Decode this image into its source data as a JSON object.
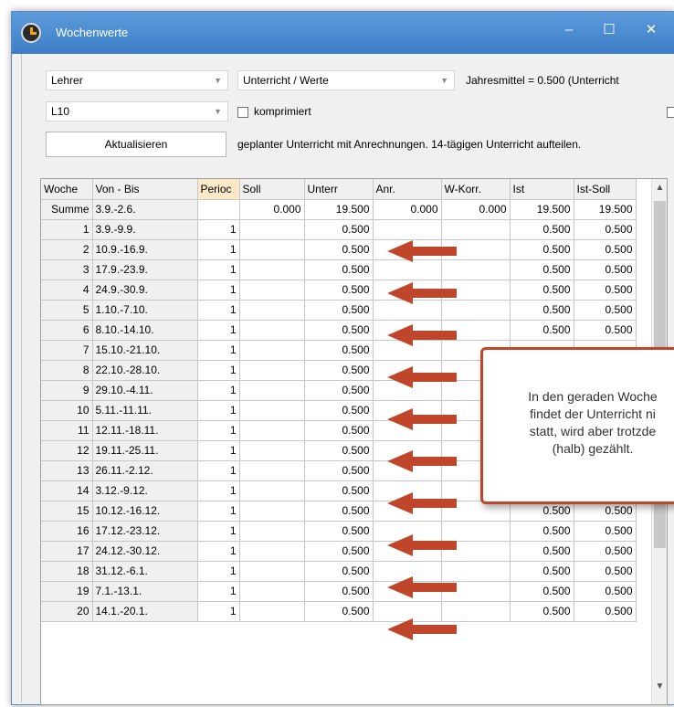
{
  "window": {
    "title": "Wochenwerte",
    "minimize_label": "–",
    "maximize_label": "☐",
    "close_label": "✕"
  },
  "controls": {
    "type_combo": "Lehrer",
    "mode_combo": "Unterricht / Werte",
    "info_text": "Jahresmittel = 0.500 (Unterricht",
    "element_combo": "L10",
    "compress_label": "komprimiert",
    "refresh_button": "Aktualisieren",
    "description": "geplanter Unterricht mit Anrechnungen. 14-tägigen Unterricht aufteilen."
  },
  "grid": {
    "headers": [
      "Woche",
      "Von - Bis",
      "Perioc",
      "Soll",
      "Unterr",
      "Anr.",
      "W-Korr.",
      "Ist",
      "Ist-Soll"
    ],
    "summary": {
      "label": "Summe",
      "range": "3.9.-2.6.",
      "period": "",
      "soll": "0.000",
      "unterr": "19.500",
      "anr": "0.000",
      "wkorr": "0.000",
      "ist": "19.500",
      "istsoll": "19.500"
    },
    "rows": [
      {
        "week": "1",
        "range": "3.9.-9.9.",
        "period": "1",
        "unterr": "0.500",
        "ist": "0.500",
        "istsoll": "0.500"
      },
      {
        "week": "2",
        "range": "10.9.-16.9.",
        "period": "1",
        "unterr": "0.500",
        "ist": "0.500",
        "istsoll": "0.500"
      },
      {
        "week": "3",
        "range": "17.9.-23.9.",
        "period": "1",
        "unterr": "0.500",
        "ist": "0.500",
        "istsoll": "0.500"
      },
      {
        "week": "4",
        "range": "24.9.-30.9.",
        "period": "1",
        "unterr": "0.500",
        "ist": "0.500",
        "istsoll": "0.500"
      },
      {
        "week": "5",
        "range": "1.10.-7.10.",
        "period": "1",
        "unterr": "0.500",
        "ist": "0.500",
        "istsoll": "0.500"
      },
      {
        "week": "6",
        "range": "8.10.-14.10.",
        "period": "1",
        "unterr": "0.500",
        "ist": "0.500",
        "istsoll": "0.500"
      },
      {
        "week": "7",
        "range": "15.10.-21.10.",
        "period": "1",
        "unterr": "0.500",
        "ist": "",
        "istsoll": ""
      },
      {
        "week": "8",
        "range": "22.10.-28.10.",
        "period": "1",
        "unterr": "0.500",
        "ist": "",
        "istsoll": ""
      },
      {
        "week": "9",
        "range": "29.10.-4.11.",
        "period": "1",
        "unterr": "0.500",
        "ist": "",
        "istsoll": ""
      },
      {
        "week": "10",
        "range": "5.11.-11.11.",
        "period": "1",
        "unterr": "0.500",
        "ist": "",
        "istsoll": ""
      },
      {
        "week": "11",
        "range": "12.11.-18.11.",
        "period": "1",
        "unterr": "0.500",
        "ist": "",
        "istsoll": ""
      },
      {
        "week": "12",
        "range": "19.11.-25.11.",
        "period": "1",
        "unterr": "0.500",
        "ist": "",
        "istsoll": ""
      },
      {
        "week": "13",
        "range": "26.11.-2.12.",
        "period": "1",
        "unterr": "0.500",
        "ist": "0.500",
        "istsoll": "0.500"
      },
      {
        "week": "14",
        "range": "3.12.-9.12.",
        "period": "1",
        "unterr": "0.500",
        "ist": "0.500",
        "istsoll": "0.500"
      },
      {
        "week": "15",
        "range": "10.12.-16.12.",
        "period": "1",
        "unterr": "0.500",
        "ist": "0.500",
        "istsoll": "0.500"
      },
      {
        "week": "16",
        "range": "17.12.-23.12.",
        "period": "1",
        "unterr": "0.500",
        "ist": "0.500",
        "istsoll": "0.500"
      },
      {
        "week": "17",
        "range": "24.12.-30.12.",
        "period": "1",
        "unterr": "0.500",
        "ist": "0.500",
        "istsoll": "0.500"
      },
      {
        "week": "18",
        "range": "31.12.-6.1.",
        "period": "1",
        "unterr": "0.500",
        "ist": "0.500",
        "istsoll": "0.500"
      },
      {
        "week": "19",
        "range": "7.1.-13.1.",
        "period": "1",
        "unterr": "0.500",
        "ist": "0.500",
        "istsoll": "0.500"
      },
      {
        "week": "20",
        "range": "14.1.-20.1.",
        "period": "1",
        "unterr": "0.500",
        "ist": "0.500",
        "istsoll": "0.500"
      }
    ]
  },
  "callout": {
    "line1": "In den geraden Woche",
    "line2": "findet der Unterricht ni",
    "line3": "statt, wird aber trotzde",
    "line4": "(halb) gezählt."
  },
  "colors": {
    "annotation_arrow": "#c0462b",
    "title_bar": "#4a8bd1",
    "period_header": "#fbe8c6"
  }
}
